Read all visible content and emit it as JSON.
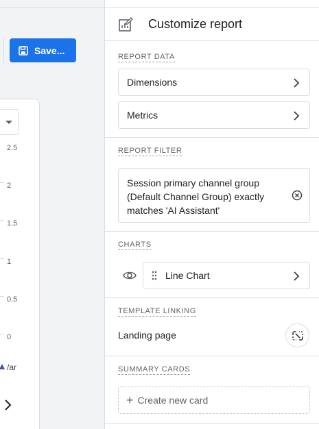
{
  "toolbar": {
    "save_label": "Save..."
  },
  "chart_preview": {
    "y_ticks": [
      "2.5",
      "2",
      "1.5",
      "1",
      "0.5",
      "0"
    ],
    "legend_label": "/ar"
  },
  "panel": {
    "title": "Customize report",
    "report_data": {
      "label": "REPORT DATA",
      "dimensions_label": "Dimensions",
      "metrics_label": "Metrics"
    },
    "report_filter": {
      "label": "REPORT FILTER",
      "filter_text": "Session primary channel group (Default Channel Group) exactly matches 'AI Assistant'"
    },
    "charts": {
      "label": "CHARTS",
      "chart_name": "Line Chart"
    },
    "template_linking": {
      "label": "TEMPLATE LINKING",
      "value": "Landing page"
    },
    "summary_cards": {
      "label": "SUMMARY CARDS",
      "create_label": "Create new card"
    }
  },
  "colors": {
    "accent": "#1a73e8",
    "legend_series": "#3c4fbd"
  }
}
